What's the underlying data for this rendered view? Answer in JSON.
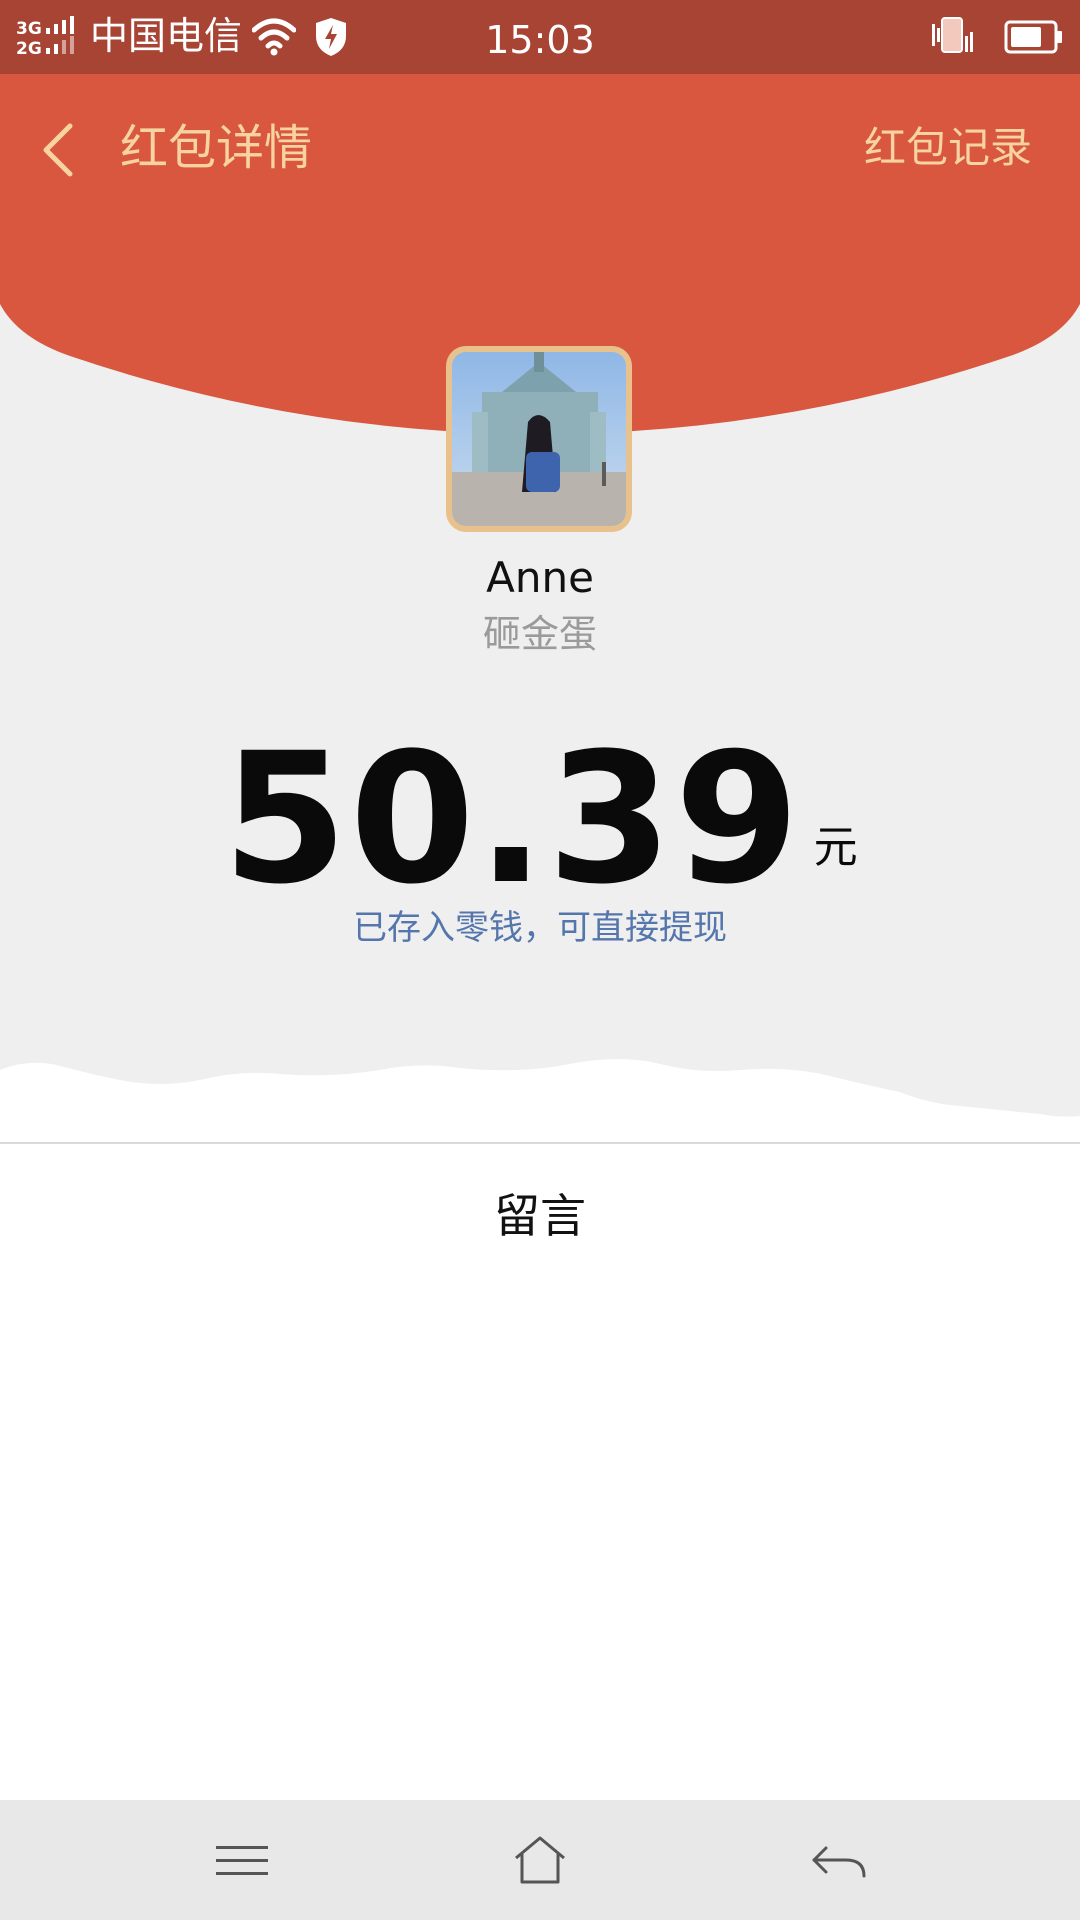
{
  "status_bar": {
    "network": "3G 2G",
    "carrier": "中国电信",
    "time": "15:03",
    "icons": [
      "signal-icon",
      "wifi-icon",
      "shield-icon",
      "vibrate-icon",
      "battery-icon"
    ]
  },
  "header": {
    "back_icon": "chevron-left-icon",
    "title": "红包详情",
    "record_link": "红包记录"
  },
  "sender": {
    "name": "Anne",
    "packet_title": "砸金蛋"
  },
  "amount": {
    "value": "50.39",
    "unit": "元",
    "note": "已存入零钱，可直接提现"
  },
  "message_section": {
    "label": "留言"
  },
  "nav_bar": {
    "icons": [
      "menu-icon",
      "home-icon",
      "back-arrow-icon"
    ]
  },
  "colors": {
    "status_bar": "#a84434",
    "header_red": "#d9573f",
    "header_text": "#f7d3a1",
    "background": "#efeff0",
    "note_blue": "#5576ac",
    "avatar_border": "#e9c18c"
  }
}
